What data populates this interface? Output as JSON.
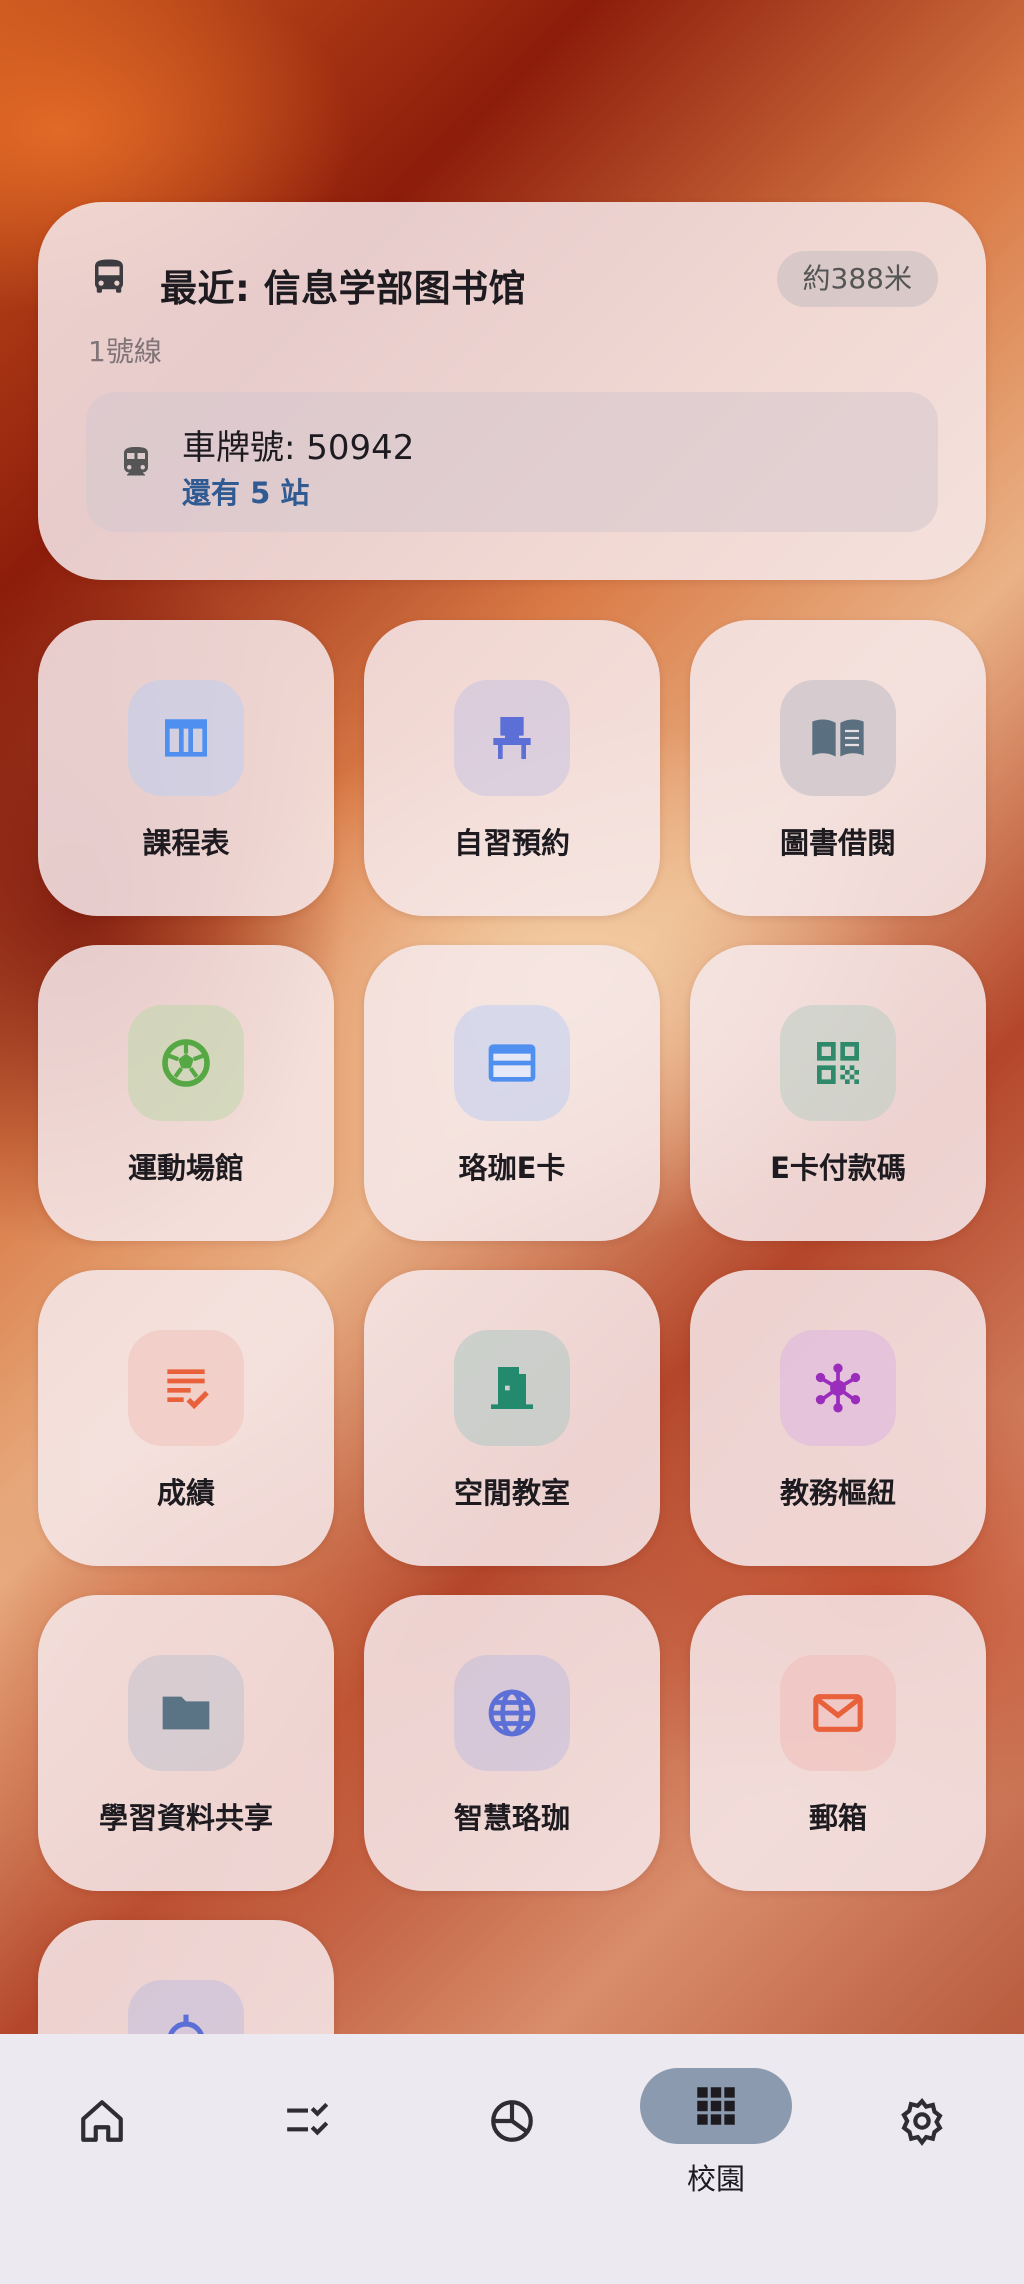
{
  "recent": {
    "title": "最近: 信息学部图书馆",
    "distance": "約388米",
    "line": "1號線",
    "plate": "車牌號: 50942",
    "stops": "還有 5 站"
  },
  "apps": [
    {
      "label": "課程表",
      "icon": "calendar-table-icon",
      "color": "#4f8ff0"
    },
    {
      "label": "自習預約",
      "icon": "chair-icon",
      "color": "#5b6fd6"
    },
    {
      "label": "圖書借閱",
      "icon": "book-icon",
      "color": "#5a6f80"
    },
    {
      "label": "運動場館",
      "icon": "soccer-ball-icon",
      "color": "#55a843"
    },
    {
      "label": "珞珈E卡",
      "icon": "credit-card-icon",
      "color": "#4f8ff0"
    },
    {
      "label": "E卡付款碼",
      "icon": "qr-code-icon",
      "color": "#2f8a6b"
    },
    {
      "label": "成績",
      "icon": "grade-list-icon",
      "color": "#e8613a"
    },
    {
      "label": "空閒教室",
      "icon": "door-icon",
      "color": "#238a6e"
    },
    {
      "label": "教務樞紐",
      "icon": "hub-icon",
      "color": "#9a2dbc"
    },
    {
      "label": "學習資料共享",
      "icon": "folder-icon",
      "color": "#5a7485"
    },
    {
      "label": "智慧珞珈",
      "icon": "globe-icon",
      "color": "#5b6fd6"
    },
    {
      "label": "郵箱",
      "icon": "mail-icon",
      "color": "#e8613a"
    },
    {
      "label": "",
      "icon": "alarm-icon",
      "color": "#5b6fd6"
    }
  ],
  "nav": {
    "home": "home-icon",
    "tasks": "checklist-icon",
    "stats": "pie-chart-icon",
    "campus_label": "校園",
    "campus_icon": "grid-apps-icon",
    "settings": "gear-icon"
  }
}
